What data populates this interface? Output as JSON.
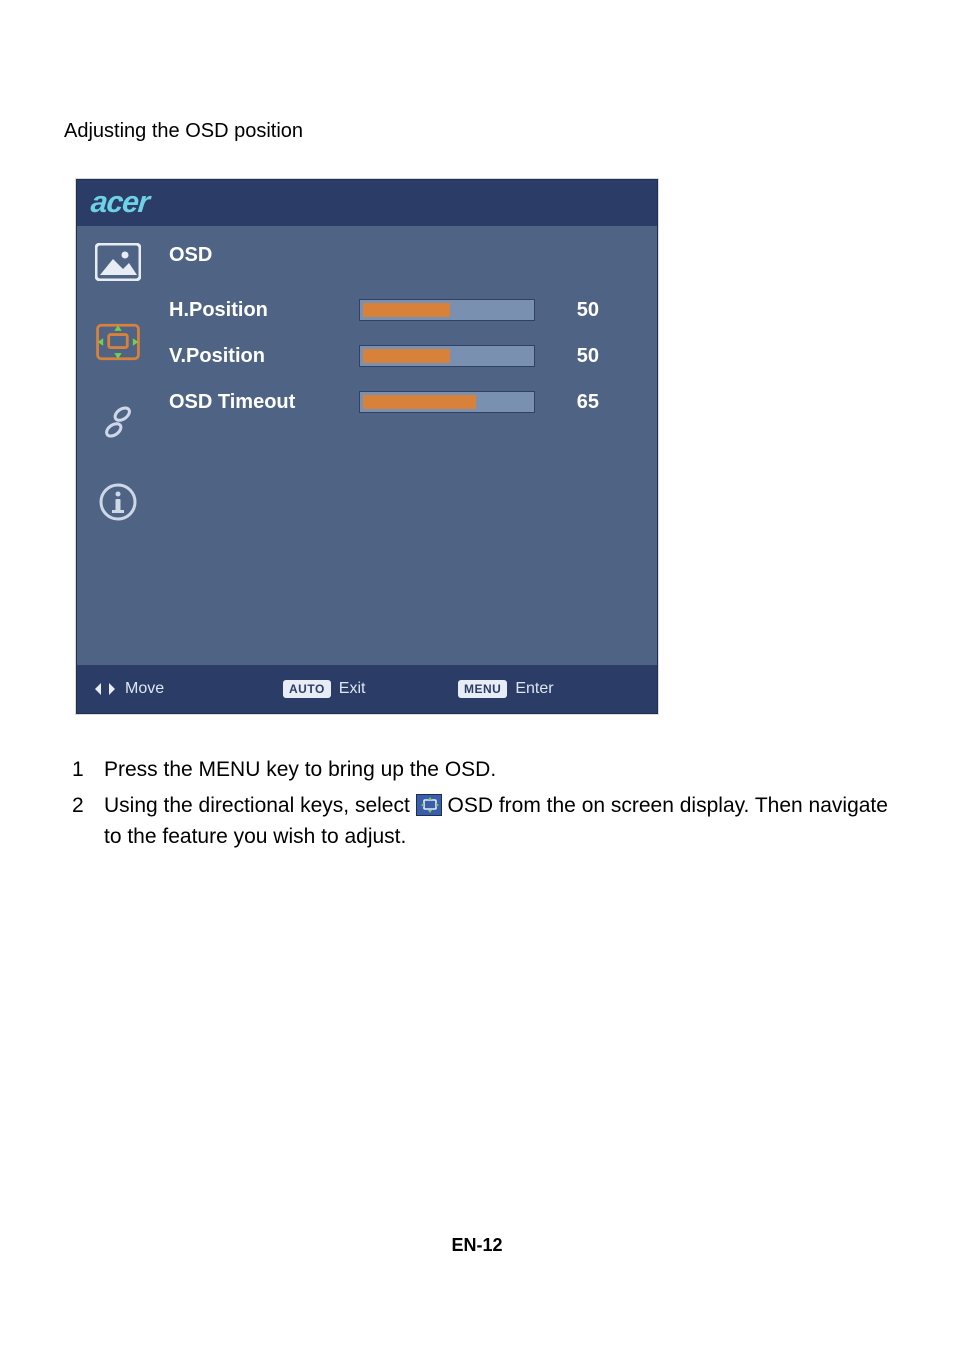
{
  "section_title": "Adjusting the OSD position",
  "brand": "acer",
  "osd": {
    "heading": "OSD",
    "rows": [
      {
        "label": "H.Position",
        "value": "50",
        "fill_pct": 50
      },
      {
        "label": "V.Position",
        "value": "50",
        "fill_pct": 50
      },
      {
        "label": "OSD Timeout",
        "value": "65",
        "fill_pct": 65
      }
    ],
    "footer": {
      "move_label": "Move",
      "auto_badge": "AUTO",
      "exit_label": "Exit",
      "menu_badge": "MENU",
      "enter_label": "Enter"
    }
  },
  "instructions": [
    {
      "num": "1",
      "before": "Press the MENU key to bring up the OSD.",
      "has_icon": false,
      "after": ""
    },
    {
      "num": "2",
      "before": "Using the directional keys, select ",
      "has_icon": true,
      "after": " OSD from the on screen display. Then navigate to the feature you wish to adjust."
    }
  ],
  "page_number": "EN-12"
}
